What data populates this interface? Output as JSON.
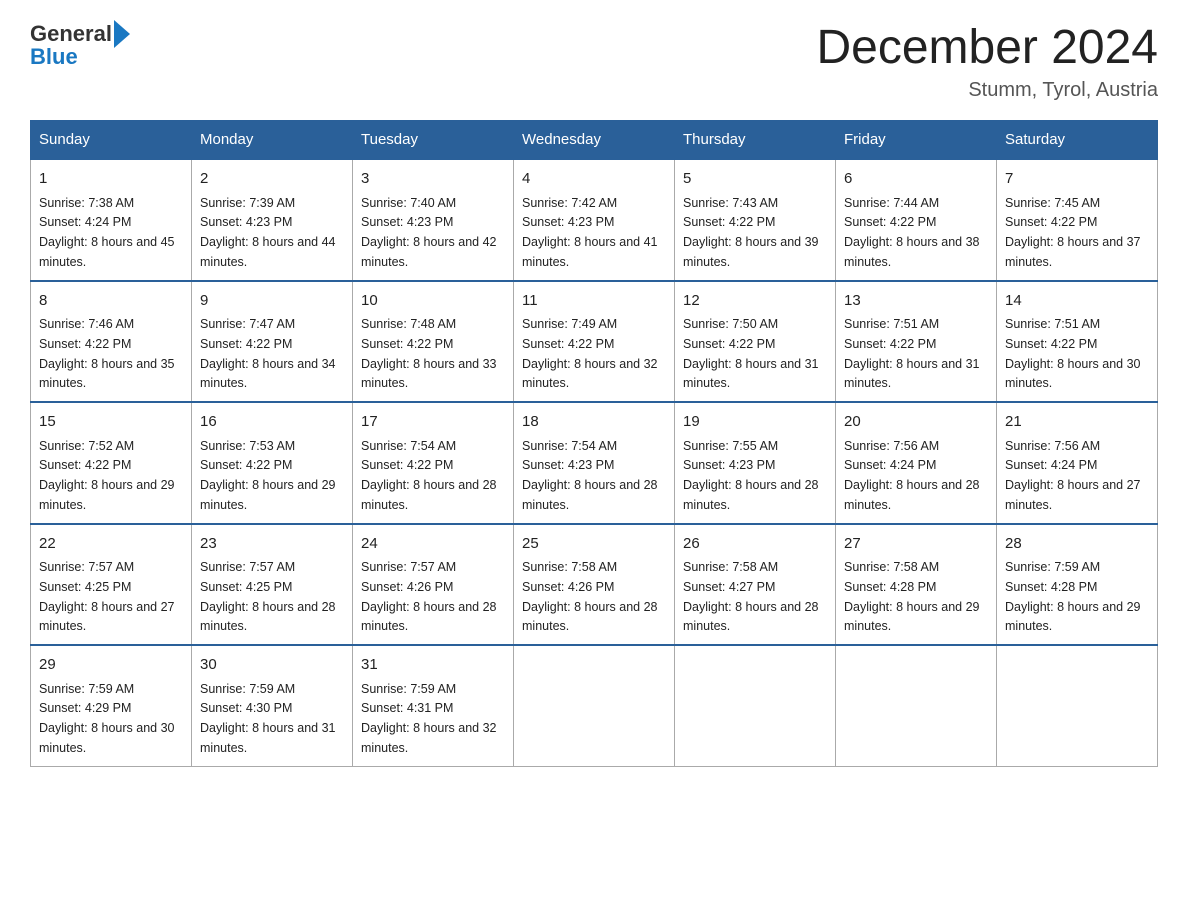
{
  "header": {
    "logo_general": "General",
    "logo_blue": "Blue",
    "month_title": "December 2024",
    "location": "Stumm, Tyrol, Austria"
  },
  "days_of_week": [
    "Sunday",
    "Monday",
    "Tuesday",
    "Wednesday",
    "Thursday",
    "Friday",
    "Saturday"
  ],
  "weeks": [
    [
      {
        "day": 1,
        "sunrise": "7:38 AM",
        "sunset": "4:24 PM",
        "daylight": "8 hours and 45 minutes."
      },
      {
        "day": 2,
        "sunrise": "7:39 AM",
        "sunset": "4:23 PM",
        "daylight": "8 hours and 44 minutes."
      },
      {
        "day": 3,
        "sunrise": "7:40 AM",
        "sunset": "4:23 PM",
        "daylight": "8 hours and 42 minutes."
      },
      {
        "day": 4,
        "sunrise": "7:42 AM",
        "sunset": "4:23 PM",
        "daylight": "8 hours and 41 minutes."
      },
      {
        "day": 5,
        "sunrise": "7:43 AM",
        "sunset": "4:22 PM",
        "daylight": "8 hours and 39 minutes."
      },
      {
        "day": 6,
        "sunrise": "7:44 AM",
        "sunset": "4:22 PM",
        "daylight": "8 hours and 38 minutes."
      },
      {
        "day": 7,
        "sunrise": "7:45 AM",
        "sunset": "4:22 PM",
        "daylight": "8 hours and 37 minutes."
      }
    ],
    [
      {
        "day": 8,
        "sunrise": "7:46 AM",
        "sunset": "4:22 PM",
        "daylight": "8 hours and 35 minutes."
      },
      {
        "day": 9,
        "sunrise": "7:47 AM",
        "sunset": "4:22 PM",
        "daylight": "8 hours and 34 minutes."
      },
      {
        "day": 10,
        "sunrise": "7:48 AM",
        "sunset": "4:22 PM",
        "daylight": "8 hours and 33 minutes."
      },
      {
        "day": 11,
        "sunrise": "7:49 AM",
        "sunset": "4:22 PM",
        "daylight": "8 hours and 32 minutes."
      },
      {
        "day": 12,
        "sunrise": "7:50 AM",
        "sunset": "4:22 PM",
        "daylight": "8 hours and 31 minutes."
      },
      {
        "day": 13,
        "sunrise": "7:51 AM",
        "sunset": "4:22 PM",
        "daylight": "8 hours and 31 minutes."
      },
      {
        "day": 14,
        "sunrise": "7:51 AM",
        "sunset": "4:22 PM",
        "daylight": "8 hours and 30 minutes."
      }
    ],
    [
      {
        "day": 15,
        "sunrise": "7:52 AM",
        "sunset": "4:22 PM",
        "daylight": "8 hours and 29 minutes."
      },
      {
        "day": 16,
        "sunrise": "7:53 AM",
        "sunset": "4:22 PM",
        "daylight": "8 hours and 29 minutes."
      },
      {
        "day": 17,
        "sunrise": "7:54 AM",
        "sunset": "4:22 PM",
        "daylight": "8 hours and 28 minutes."
      },
      {
        "day": 18,
        "sunrise": "7:54 AM",
        "sunset": "4:23 PM",
        "daylight": "8 hours and 28 minutes."
      },
      {
        "day": 19,
        "sunrise": "7:55 AM",
        "sunset": "4:23 PM",
        "daylight": "8 hours and 28 minutes."
      },
      {
        "day": 20,
        "sunrise": "7:56 AM",
        "sunset": "4:24 PM",
        "daylight": "8 hours and 28 minutes."
      },
      {
        "day": 21,
        "sunrise": "7:56 AM",
        "sunset": "4:24 PM",
        "daylight": "8 hours and 27 minutes."
      }
    ],
    [
      {
        "day": 22,
        "sunrise": "7:57 AM",
        "sunset": "4:25 PM",
        "daylight": "8 hours and 27 minutes."
      },
      {
        "day": 23,
        "sunrise": "7:57 AM",
        "sunset": "4:25 PM",
        "daylight": "8 hours and 28 minutes."
      },
      {
        "day": 24,
        "sunrise": "7:57 AM",
        "sunset": "4:26 PM",
        "daylight": "8 hours and 28 minutes."
      },
      {
        "day": 25,
        "sunrise": "7:58 AM",
        "sunset": "4:26 PM",
        "daylight": "8 hours and 28 minutes."
      },
      {
        "day": 26,
        "sunrise": "7:58 AM",
        "sunset": "4:27 PM",
        "daylight": "8 hours and 28 minutes."
      },
      {
        "day": 27,
        "sunrise": "7:58 AM",
        "sunset": "4:28 PM",
        "daylight": "8 hours and 29 minutes."
      },
      {
        "day": 28,
        "sunrise": "7:59 AM",
        "sunset": "4:28 PM",
        "daylight": "8 hours and 29 minutes."
      }
    ],
    [
      {
        "day": 29,
        "sunrise": "7:59 AM",
        "sunset": "4:29 PM",
        "daylight": "8 hours and 30 minutes."
      },
      {
        "day": 30,
        "sunrise": "7:59 AM",
        "sunset": "4:30 PM",
        "daylight": "8 hours and 31 minutes."
      },
      {
        "day": 31,
        "sunrise": "7:59 AM",
        "sunset": "4:31 PM",
        "daylight": "8 hours and 32 minutes."
      },
      null,
      null,
      null,
      null
    ]
  ]
}
